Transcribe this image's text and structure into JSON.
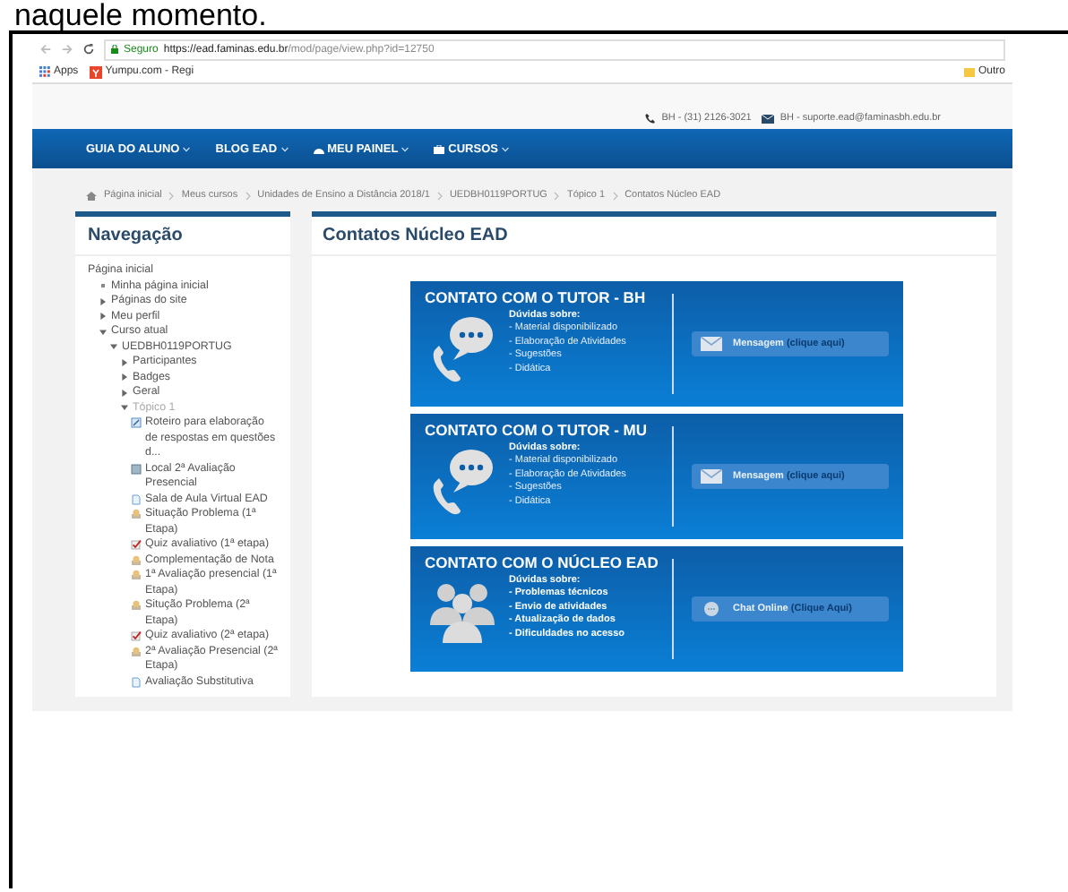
{
  "document_text": "naquele momento.",
  "browser": {
    "secure_label": "Seguro",
    "url_host": "https://ead.faminas.edu.br",
    "url_path": "/mod/page/view.php?id=12750",
    "bookmarks": [
      {
        "kind": "apps",
        "label": "Apps"
      },
      {
        "kind": "site",
        "label": "Yumpu.com - Regi"
      }
    ],
    "other_bookmarks": "Outro"
  },
  "header": {
    "phone": "BH - (31) 2126-3021",
    "email": "BH - suporte.ead@faminasbh.edu.br"
  },
  "nav_menu": [
    {
      "label": "GUIA DO ALUNO"
    },
    {
      "label": "BLOG EAD"
    },
    {
      "label": "MEU PAINEL"
    },
    {
      "label": "CURSOS"
    }
  ],
  "breadcrumb": [
    "Página inicial",
    "Meus cursos",
    "Unidades de Ensino a Distância 2018/1",
    "UEDBH0119PORTUG",
    "Tópico 1",
    "Contatos Núcleo EAD"
  ],
  "navigation": {
    "title": "Navegação",
    "tree": [
      {
        "label": "Página inicial",
        "children": [
          {
            "kind": "bullet",
            "label": "Minha página inicial"
          },
          {
            "kind": "branch",
            "label": "Páginas do site",
            "expanded": false,
            "dimmed": false
          },
          {
            "kind": "branch",
            "label": "Meu perfil",
            "expanded": false,
            "dimmed": false
          },
          {
            "kind": "branch",
            "label": "Curso atual",
            "expanded": true,
            "dimmed": false,
            "children": [
              {
                "kind": "branch",
                "label": "UEDBH0119PORTUG",
                "expanded": true,
                "dimmed": false,
                "children": [
                  {
                    "kind": "branch",
                    "label": "Participantes",
                    "expanded": false,
                    "dimmed": false
                  },
                  {
                    "kind": "branch",
                    "label": "Badges",
                    "expanded": false,
                    "dimmed": false
                  },
                  {
                    "kind": "branch",
                    "label": "Geral",
                    "expanded": false,
                    "dimmed": false
                  },
                  {
                    "kind": "branch",
                    "label": "Tópico 1",
                    "expanded": true,
                    "dimmed": true,
                    "children": [
                      {
                        "kind": "url",
                        "label": "Roteiro para elaboração de respostas em questões d..."
                      },
                      {
                        "kind": "place",
                        "label": "Local 2ª Avaliação Presencial"
                      },
                      {
                        "kind": "page",
                        "label": "Sala de Aula Virtual EAD"
                      },
                      {
                        "kind": "assign",
                        "label": "Situação Problema (1ª Etapa)"
                      },
                      {
                        "kind": "quiz",
                        "label": "Quiz avaliativo (1ª etapa)"
                      },
                      {
                        "kind": "assign",
                        "label": "Complementação de Nota"
                      },
                      {
                        "kind": "assign",
                        "label": "1ª Avaliação presencial (1ª Etapa)"
                      },
                      {
                        "kind": "assign",
                        "label": "Situção Problema (2ª Etapa)"
                      },
                      {
                        "kind": "quiz",
                        "label": "Quiz avaliativo (2ª etapa)"
                      },
                      {
                        "kind": "assign",
                        "label": "2ª Avaliação Presencial (2ª Etapa)"
                      },
                      {
                        "kind": "page",
                        "label": "Avaliação Substitutiva"
                      }
                    ]
                  }
                ]
              }
            ]
          }
        ]
      }
    ]
  },
  "main": {
    "title": "Contatos Núcleo EAD",
    "cards": [
      {
        "title": "CONTATO COM O TUTOR - BH",
        "subtitle": "Dúvidas sobre:",
        "bold_items": false,
        "items": [
          "- Material disponibilizado",
          "- Elaboração de Atividades",
          "- Sugestões",
          "- Didática"
        ],
        "button": {
          "label": "Mensagem",
          "hint": "(clique aqui)"
        }
      },
      {
        "title": "CONTATO COM O TUTOR - MU",
        "subtitle": "Dúvidas sobre:",
        "bold_items": false,
        "items": [
          "- Material disponibilizado",
          "- Elaboração de Atividades",
          "- Sugestões",
          "- Didática"
        ],
        "button": {
          "label": "Mensagem",
          "hint": "(clique aqui)"
        }
      },
      {
        "title": "CONTATO COM O NÚCLEO EAD",
        "subtitle": "Dúvidas sobre:",
        "bold_items": true,
        "items": [
          "- Problemas técnicos",
          "- Envio de atividades",
          "- Atualização de dados",
          "- Dificuldades no acesso"
        ],
        "button": {
          "label": "Chat Online",
          "hint": "(Clique Aqui)"
        }
      }
    ]
  }
}
